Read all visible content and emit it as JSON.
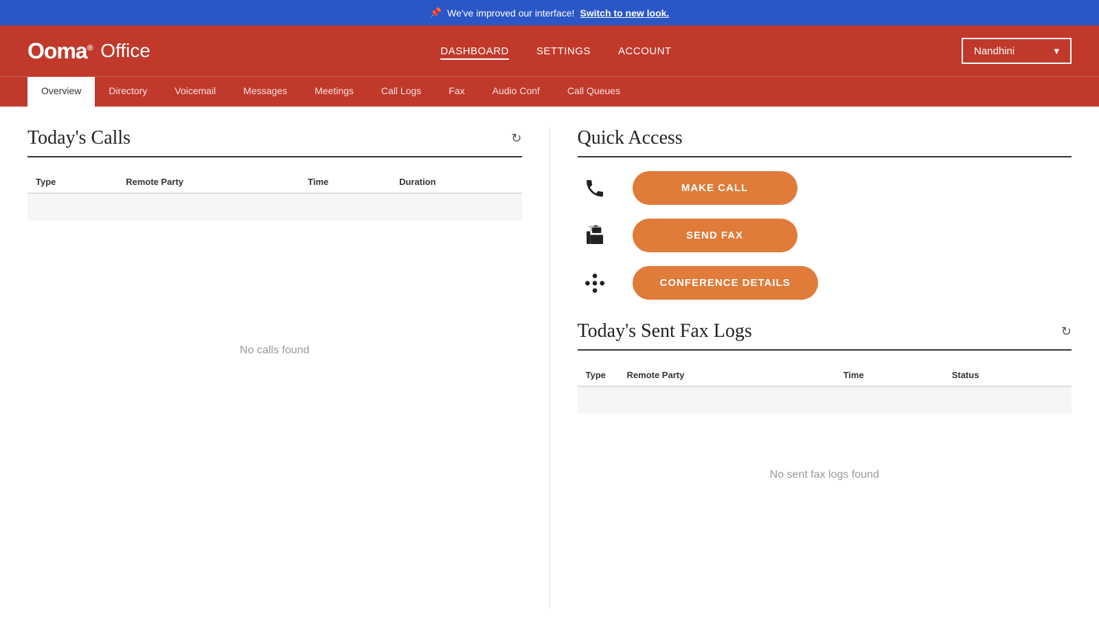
{
  "announcement": {
    "message": "We've improved our interface!",
    "link_text": "Switch to new look."
  },
  "header": {
    "logo_ooma": "Ooma",
    "logo_office": "Office",
    "nav": [
      {
        "label": "DASHBOARD",
        "active": true
      },
      {
        "label": "SETTINGS",
        "active": false
      },
      {
        "label": "ACCOUNT",
        "active": false
      }
    ],
    "user": "Nandhini"
  },
  "subnav": {
    "tabs": [
      {
        "label": "Overview",
        "active": true
      },
      {
        "label": "Directory",
        "active": false
      },
      {
        "label": "Voicemail",
        "active": false
      },
      {
        "label": "Messages",
        "active": false
      },
      {
        "label": "Meetings",
        "active": false
      },
      {
        "label": "Call Logs",
        "active": false
      },
      {
        "label": "Fax",
        "active": false
      },
      {
        "label": "Audio Conf",
        "active": false
      },
      {
        "label": "Call Queues",
        "active": false
      }
    ]
  },
  "todays_calls": {
    "title": "Today's Calls",
    "columns": [
      "Type",
      "Remote Party",
      "Time",
      "Duration"
    ],
    "no_data_message": "No calls found"
  },
  "quick_access": {
    "title": "Quick Access",
    "items": [
      {
        "icon": "phone",
        "label": "MAKE CALL"
      },
      {
        "icon": "fax",
        "label": "SEND FAX"
      },
      {
        "icon": "conference",
        "label": "CONFERENCE DETAILS"
      }
    ]
  },
  "fax_logs": {
    "title": "Today's Sent Fax Logs",
    "columns": [
      "Type",
      "Remote Party",
      "Time",
      "Status"
    ],
    "no_data_message": "No sent fax logs found"
  }
}
